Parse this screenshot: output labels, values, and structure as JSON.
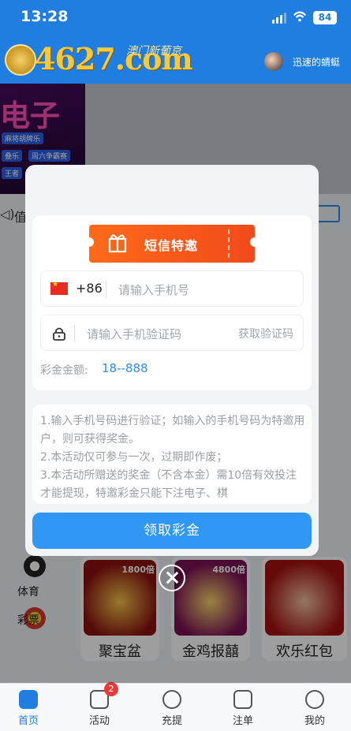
{
  "status_bar": {
    "time": "13:28",
    "battery": "84"
  },
  "header": {
    "logo_text": "4627.com",
    "logo_sub": "澳门新葡京",
    "user_name": "迅速的蜻蜓"
  },
  "banner": {
    "big_text": "电子",
    "tags": [
      "麻将胡牌乐",
      "叠乐",
      "周六争霸赛",
      "王者"
    ]
  },
  "notice": {
    "text": "值"
  },
  "side_categories": [
    "体育",
    "彩票"
  ],
  "games": [
    {
      "name": "聚宝盆",
      "multiplier": "1800倍"
    },
    {
      "name": "金鸡报囍",
      "multiplier": "4800倍"
    },
    {
      "name": "欢乐红包",
      "multiplier": ""
    }
  ],
  "tabbar": {
    "items": [
      {
        "label": "首页",
        "icon": "home-icon"
      },
      {
        "label": "活动",
        "icon": "star-icon",
        "badge": "2"
      },
      {
        "label": "充提",
        "icon": "recharge-icon"
      },
      {
        "label": "注单",
        "icon": "order-icon"
      },
      {
        "label": "我的",
        "icon": "profile-icon"
      }
    ]
  },
  "modal": {
    "ribbon_text": "短信特邀",
    "phone": {
      "country_code": "+86",
      "placeholder": "请输入手机号"
    },
    "sms": {
      "placeholder": "请输入手机验证码",
      "get_code_label": "获取验证码"
    },
    "reward": {
      "label": "彩金金额:",
      "value": "18--888"
    },
    "rules": [
      "1.输入手机号码进行验证；如输入的手机号码为特邀用户，则可获得奖金。",
      "2.本活动仅可参与一次，过期即作废；",
      "3.本活动所赠送的奖金（不含本金）需10倍有效投注才能提现，特邀彩金只能下注电子、棋"
    ],
    "claim_label": "领取彩金"
  },
  "colors": {
    "primary": "#1f7ee0",
    "button": "#3197f5",
    "ribbon": "#ff6a1a",
    "reward": "#2f8cf0"
  }
}
